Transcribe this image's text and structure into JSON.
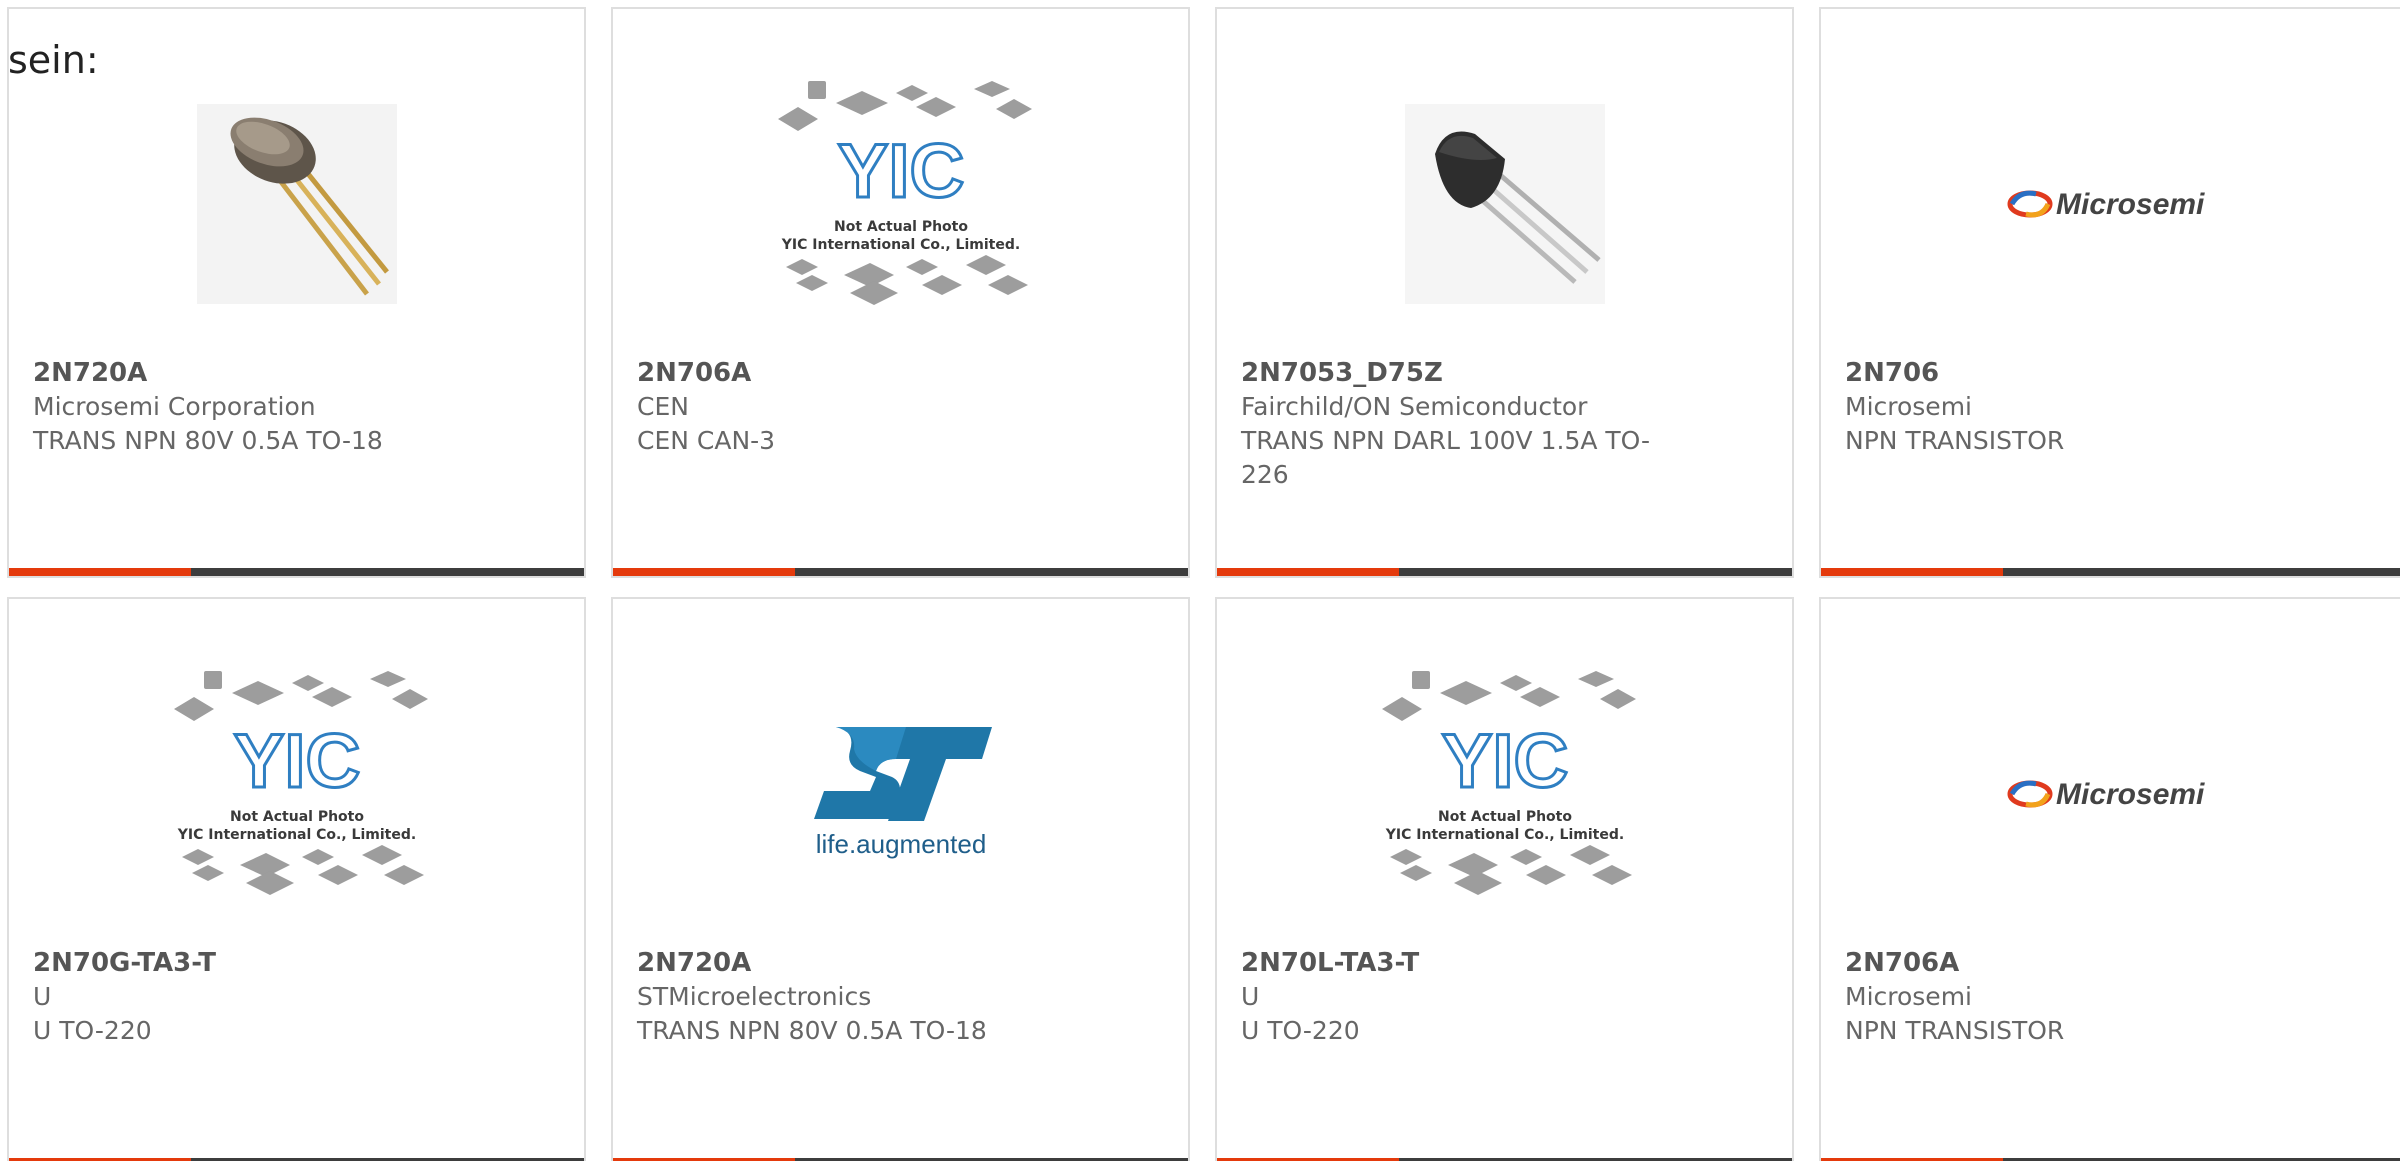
{
  "intro_text": "sein:",
  "colors": {
    "accent": "#e43a0c",
    "bar": "#3d3d3d",
    "border": "#dedede",
    "text": "#666666"
  },
  "products": [
    {
      "part_number": "2N720A",
      "manufacturer": "Microsemi Corporation",
      "description": "TRANS NPN 80V 0.5A TO-18",
      "image": "to18-transistor-photo"
    },
    {
      "part_number": "2N706A",
      "manufacturer": "CEN",
      "description": "CEN CAN-3",
      "image": "yic-placeholder",
      "image_text": [
        "Not Actual Photo",
        "YIC International Co., Limited."
      ]
    },
    {
      "part_number": "2N7053_D75Z",
      "manufacturer": "Fairchild/ON Semiconductor",
      "description": "TRANS NPN DARL 100V 1.5A TO-226",
      "image": "to92-transistor-photo"
    },
    {
      "part_number": "2N706",
      "manufacturer": "Microsemi",
      "description": "NPN TRANSISTOR",
      "image": "microsemi-logo",
      "image_text": [
        "Microsemi"
      ]
    },
    {
      "part_number": "2N70G-TA3-T",
      "manufacturer": "U",
      "description": "U TO-220",
      "image": "yic-placeholder",
      "image_text": [
        "Not Actual Photo",
        "YIC International Co., Limited."
      ]
    },
    {
      "part_number": "2N720A",
      "manufacturer": "STMicroelectronics",
      "description": "TRANS NPN 80V 0.5A TO-18",
      "image": "st-logo",
      "image_text": [
        "life.augmented"
      ]
    },
    {
      "part_number": "2N70L-TA3-T",
      "manufacturer": "U",
      "description": "U TO-220",
      "image": "yic-placeholder",
      "image_text": [
        "Not Actual Photo",
        "YIC International Co., Limited."
      ]
    },
    {
      "part_number": "2N706A",
      "manufacturer": "Microsemi",
      "description": "NPN TRANSISTOR",
      "image": "microsemi-logo",
      "image_text": [
        "Microsemi"
      ]
    }
  ]
}
